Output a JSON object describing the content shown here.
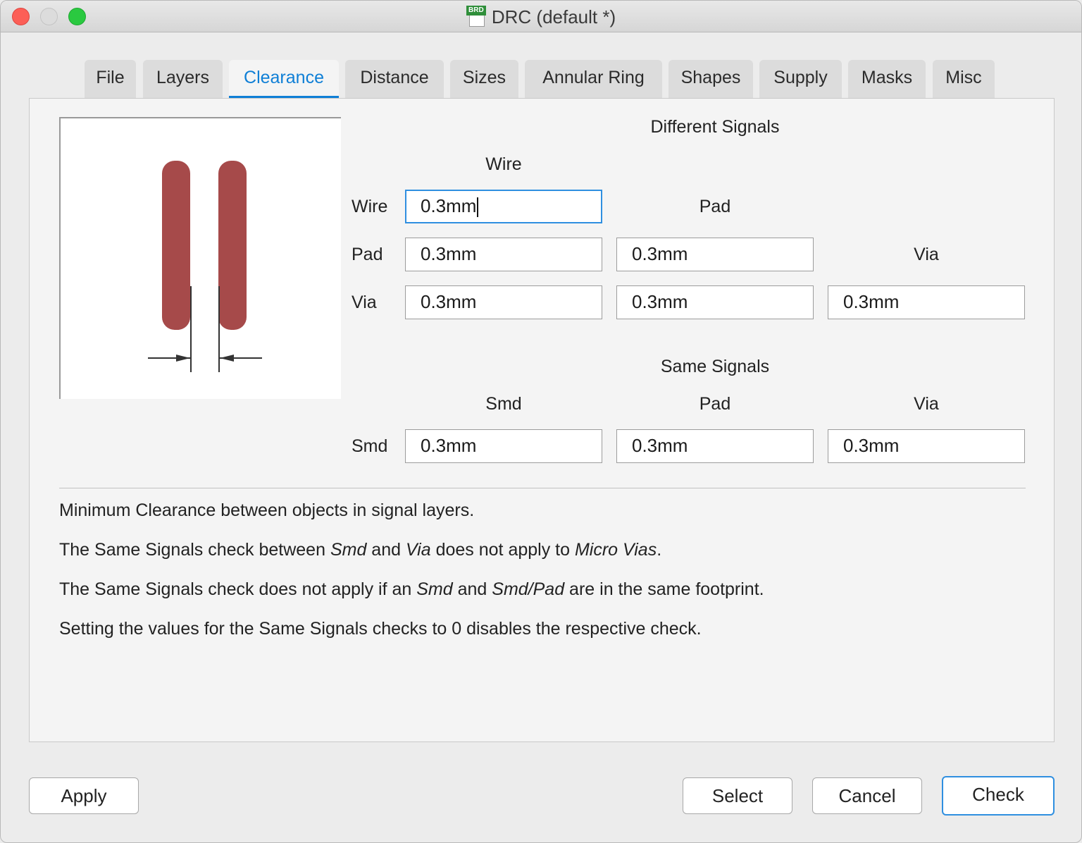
{
  "window": {
    "title": "DRC (default *)",
    "file_badge": "BRD"
  },
  "tabs": [
    {
      "label": "File"
    },
    {
      "label": "Layers"
    },
    {
      "label": "Clearance",
      "active": true
    },
    {
      "label": "Distance"
    },
    {
      "label": "Sizes"
    },
    {
      "label": "Annular Ring"
    },
    {
      "label": "Shapes"
    },
    {
      "label": "Supply"
    },
    {
      "label": "Masks"
    },
    {
      "label": "Misc"
    }
  ],
  "clearance": {
    "different_signals": {
      "heading": "Different Signals",
      "col_wire": "Wire",
      "col_pad": "Pad",
      "col_via": "Via",
      "row_wire": "Wire",
      "row_pad": "Pad",
      "row_via": "Via",
      "wire_wire": "0.3mm",
      "pad_wire": "0.3mm",
      "pad_pad": "0.3mm",
      "via_wire": "0.3mm",
      "via_pad": "0.3mm",
      "via_via": "0.3mm"
    },
    "same_signals": {
      "heading": "Same Signals",
      "col_smd": "Smd",
      "col_pad": "Pad",
      "col_via": "Via",
      "row_smd": "Smd",
      "smd_smd": "0.3mm",
      "smd_pad": "0.3mm",
      "smd_via": "0.3mm"
    },
    "description": {
      "line1": "Minimum Clearance between objects in signal layers.",
      "line2_a": "The Same Signals check between ",
      "line2_b": "Smd",
      "line2_c": " and ",
      "line2_d": "Via",
      "line2_e": " does not apply to ",
      "line2_f": "Micro Vias",
      "line2_g": ".",
      "line3_a": "The Same Signals check does not apply if an ",
      "line3_b": "Smd",
      "line3_c": " and ",
      "line3_d": "Smd/Pad",
      "line3_e": " are in the same footprint.",
      "line4": "Setting the values for the Same Signals checks to 0 disables the respective check."
    },
    "preview_color": "#a64a4a"
  },
  "buttons": {
    "apply": "Apply",
    "select": "Select",
    "cancel": "Cancel",
    "check": "Check"
  },
  "colors": {
    "accent": "#0f7fd6",
    "focus_ring": "#2f8fe0",
    "traffic_red": "#fc5f57",
    "traffic_green": "#2ac940"
  }
}
